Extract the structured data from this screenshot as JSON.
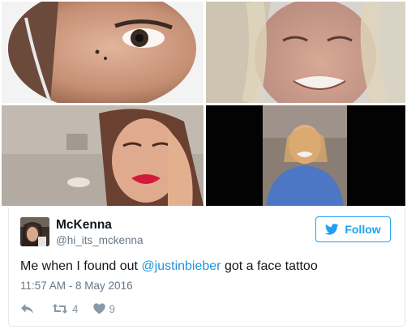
{
  "media": {
    "images": [
      {
        "subject": "close-up eye"
      },
      {
        "subject": "crying face"
      },
      {
        "subject": "pouting face"
      },
      {
        "subject": "crying girl"
      }
    ]
  },
  "tweet": {
    "author": {
      "display_name": "McKenna",
      "handle": "@hi_its_mckenna"
    },
    "follow_label": "Follow",
    "text_before": "Me when I found out ",
    "mention": "@justinbieber",
    "text_after": " got a face tattoo",
    "timestamp": "11:57 AM - 8 May 2016",
    "retweet_count": "4",
    "like_count": "9"
  },
  "colors": {
    "brand_blue": "#1da1f2",
    "link_blue": "#1b95e0",
    "secondary_text": "#657786",
    "icon_gray": "#8899a6"
  },
  "icons": {
    "follow": "twitter-bird-icon",
    "reply": "reply-icon",
    "retweet": "retweet-icon",
    "like": "heart-icon"
  }
}
